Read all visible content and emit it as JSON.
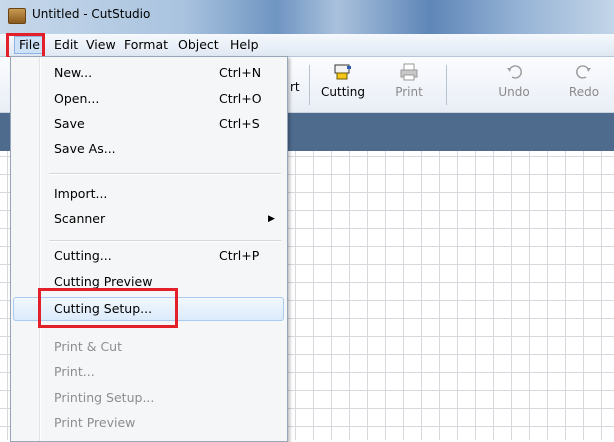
{
  "window": {
    "title": "Untitled - CutStudio"
  },
  "menubar": {
    "items": [
      "File",
      "Edit",
      "View",
      "Format",
      "Object",
      "Help"
    ]
  },
  "toolbar": {
    "partial_label": "rt",
    "buttons": [
      {
        "label": "Cutting",
        "icon": "cutting-icon",
        "enabled": true
      },
      {
        "label": "Print",
        "icon": "printer-icon",
        "enabled": false
      },
      {
        "label": "Undo",
        "icon": "undo-icon",
        "enabled": false
      },
      {
        "label": "Redo",
        "icon": "redo-icon",
        "enabled": false
      }
    ]
  },
  "file_menu": {
    "items": [
      {
        "label": "New...",
        "shortcut": "Ctrl+N",
        "enabled": true
      },
      {
        "label": "Open...",
        "shortcut": "Ctrl+O",
        "enabled": true
      },
      {
        "label": "Save",
        "shortcut": "Ctrl+S",
        "enabled": true
      },
      {
        "label": "Save As...",
        "shortcut": "",
        "enabled": true
      },
      {
        "label": "Import...",
        "shortcut": "",
        "enabled": true
      },
      {
        "label": "Scanner",
        "shortcut": "",
        "enabled": true,
        "submenu": true
      },
      {
        "label": "Cutting...",
        "shortcut": "Ctrl+P",
        "enabled": true
      },
      {
        "label": "Cutting Preview",
        "shortcut": "",
        "enabled": true
      },
      {
        "label": "Cutting Setup...",
        "shortcut": "",
        "enabled": true,
        "hovered": true
      },
      {
        "label": "Print & Cut",
        "shortcut": "",
        "enabled": false
      },
      {
        "label": "Print...",
        "shortcut": "",
        "enabled": false
      },
      {
        "label": "Printing Setup...",
        "shortcut": "",
        "enabled": false
      },
      {
        "label": "Print Preview",
        "shortcut": "",
        "enabled": false
      }
    ]
  },
  "colors": {
    "highlight_box": "#e3202a",
    "band": "#4e6b8e",
    "grid_line": "#d6d9de"
  }
}
